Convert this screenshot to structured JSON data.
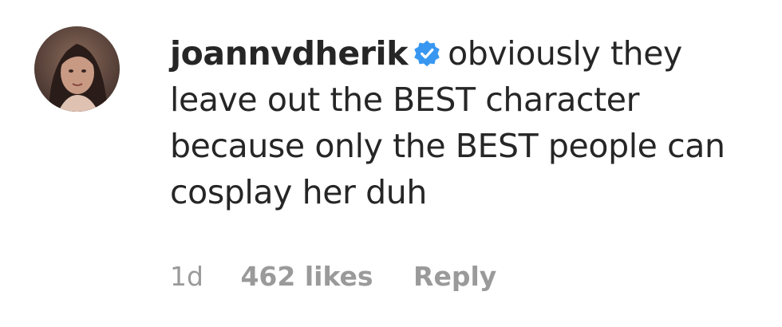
{
  "comment": {
    "username": "joannvdherik",
    "verified_icon": "verified-badge-icon",
    "text": "obviously they leave out the BEST character because only the BEST people can cosplay her duh",
    "time_ago": "1d",
    "likes": "462 likes",
    "reply_label": "Reply"
  },
  "colors": {
    "text": "#262626",
    "meta": "#9a9a9a",
    "verified": "#3897f0"
  }
}
